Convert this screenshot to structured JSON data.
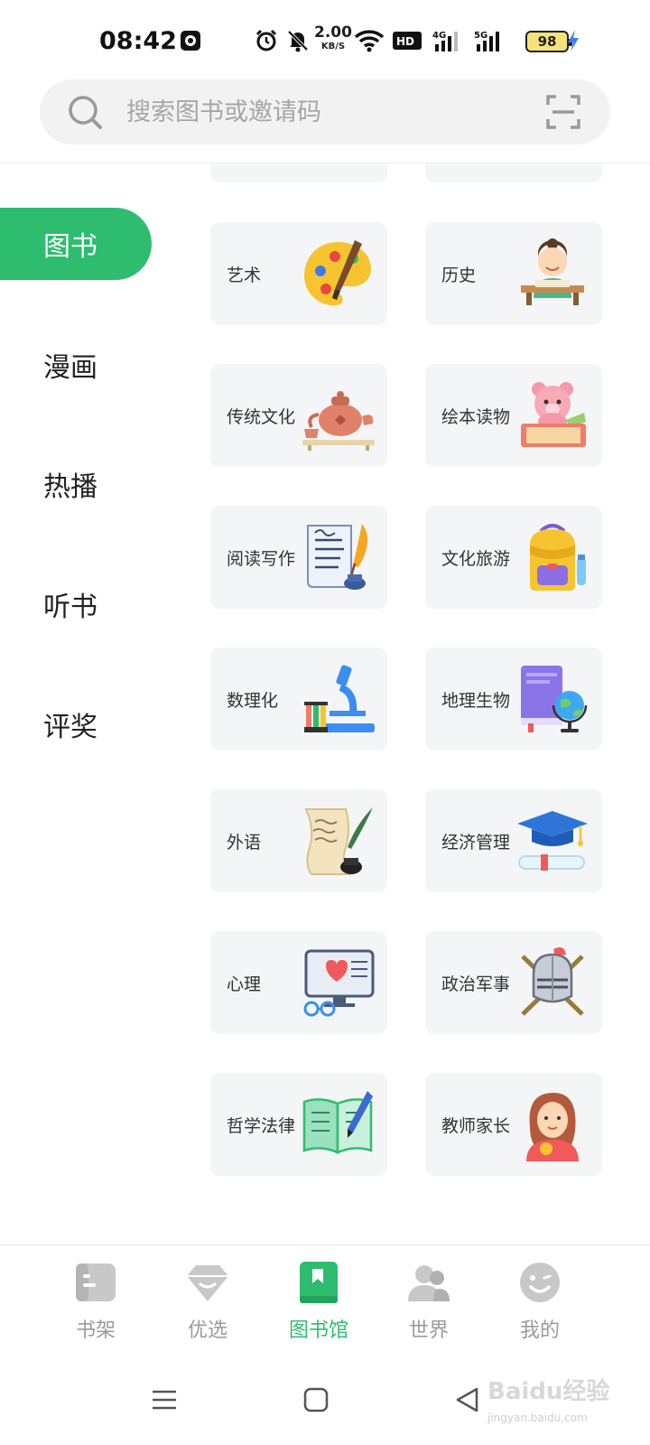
{
  "status_bar": {
    "time": "08:42",
    "net_speed": "2.00",
    "net_unit": "KB/S",
    "battery": "98",
    "icons": [
      "app-badge-icon",
      "alarm-icon",
      "mute-icon",
      "wifi-icon",
      "hd-icon",
      "4g-signal-icon",
      "5g-signal-icon",
      "charging-icon"
    ]
  },
  "search": {
    "placeholder": "搜索图书或邀请码",
    "scan_icon": "scan-icon"
  },
  "sidebar": {
    "items": [
      {
        "label": "图书",
        "active": true
      },
      {
        "label": "漫画",
        "active": false
      },
      {
        "label": "热播",
        "active": false
      },
      {
        "label": "听书",
        "active": false
      },
      {
        "label": "评奖",
        "active": false
      }
    ]
  },
  "categories": [
    {
      "label": "艺术",
      "icon": "palette-icon"
    },
    {
      "label": "历史",
      "icon": "scholar-icon"
    },
    {
      "label": "传统文化",
      "icon": "teapot-icon"
    },
    {
      "label": "绘本读物",
      "icon": "teddy-bear-icon"
    },
    {
      "label": "阅读写作",
      "icon": "quill-paper-icon"
    },
    {
      "label": "文化旅游",
      "icon": "backpack-icon"
    },
    {
      "label": "数理化",
      "icon": "microscope-icon"
    },
    {
      "label": "地理生物",
      "icon": "globe-book-icon"
    },
    {
      "label": "外语",
      "icon": "scroll-quill-icon"
    },
    {
      "label": "经济管理",
      "icon": "graduation-cap-icon"
    },
    {
      "label": "心理",
      "icon": "monitor-heart-icon"
    },
    {
      "label": "政治军事",
      "icon": "knight-helmet-icon"
    },
    {
      "label": "哲学法律",
      "icon": "open-book-pen-icon"
    },
    {
      "label": "教师家长",
      "icon": "teacher-avatar-icon"
    }
  ],
  "bottom_nav": {
    "tabs": [
      {
        "label": "书架",
        "icon": "bookshelf-icon",
        "active": false
      },
      {
        "label": "优选",
        "icon": "diamond-icon",
        "active": false
      },
      {
        "label": "图书馆",
        "icon": "library-icon",
        "active": true
      },
      {
        "label": "世界",
        "icon": "people-icon",
        "active": false
      },
      {
        "label": "我的",
        "icon": "smiley-icon",
        "active": false
      }
    ]
  },
  "watermark": {
    "text": "Baidu经验",
    "sub": "jingyan.baidu.com"
  },
  "colors": {
    "accent": "#2ebd6e",
    "card_bg": "#f4f5f7",
    "inactive": "#9a9a9a"
  }
}
